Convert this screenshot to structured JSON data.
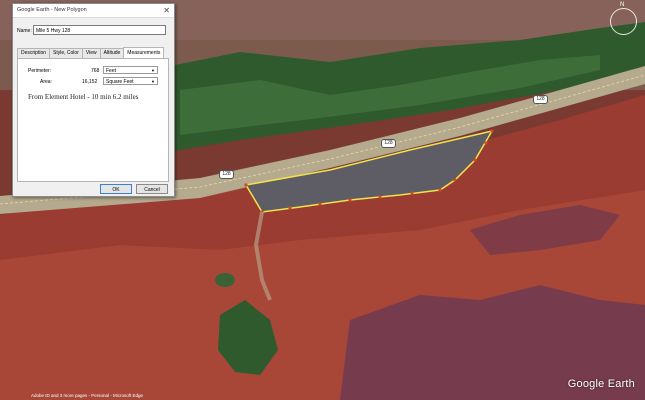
{
  "dialog": {
    "title": "Google Earth - New Polygon",
    "close_glyph": "✕",
    "name_label": "Name:",
    "name_value": "Mile 5 Hwy 128",
    "tabs": [
      {
        "label": "Description"
      },
      {
        "label": "Style, Color"
      },
      {
        "label": "View"
      },
      {
        "label": "Altitude"
      },
      {
        "label": "Measurements"
      }
    ],
    "perimeter_label": "Perimeter:",
    "perimeter_value": "768",
    "perimeter_unit": "Feet",
    "area_label": "Area:",
    "area_value": "16,152",
    "area_unit": "Square Feet",
    "description_text": "From Element Hotel - 10 min 6.2 miles",
    "ok_label": "OK",
    "cancel_label": "Cancel"
  },
  "map": {
    "road_shields": [
      "128",
      "128",
      "128"
    ],
    "compass_label": "N",
    "logo_text": "Google Earth",
    "status_text": "Adobe ID and 3 more pages - Personal - Microsoft Edge"
  },
  "colors": {
    "river": "#7d5a4e",
    "vegetation": "#2f5a2e",
    "road": "#b5a98e",
    "parking": "#5e5d66",
    "rock": "#9a3c32",
    "polygon_outline": "#f2e24a",
    "vertex": "#d24a1e"
  }
}
